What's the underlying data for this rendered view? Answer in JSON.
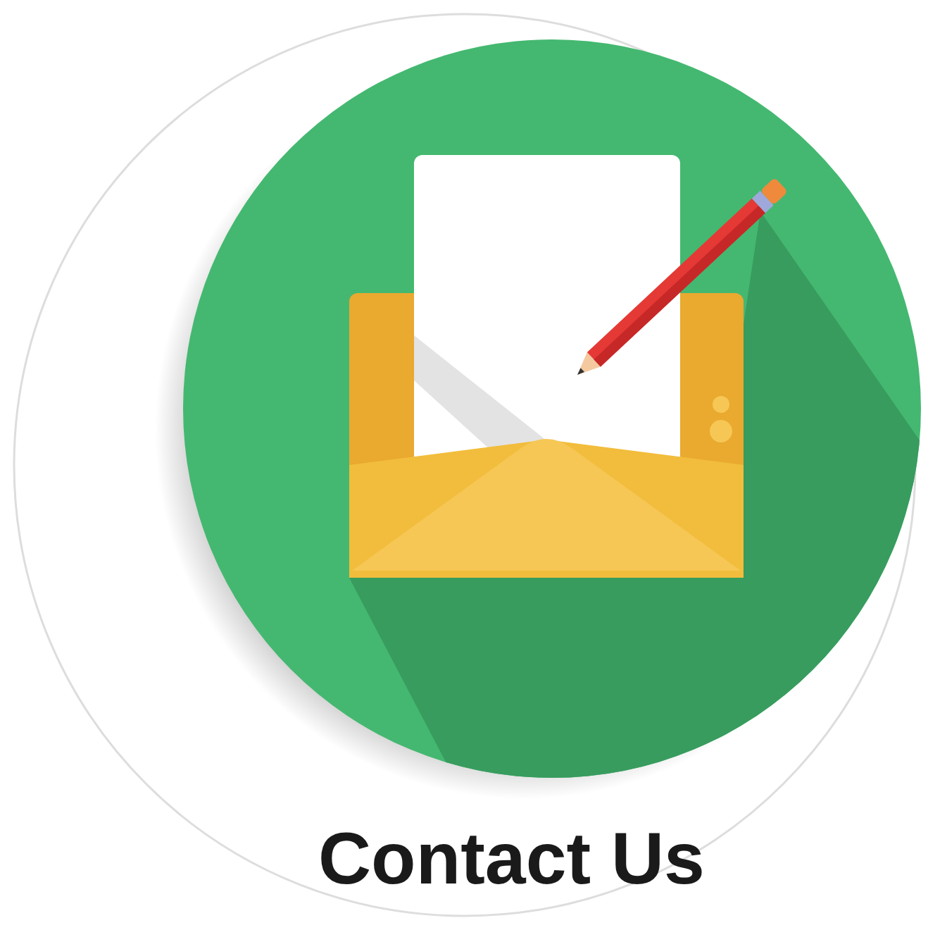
{
  "button": {
    "label": "Contact Us"
  }
}
